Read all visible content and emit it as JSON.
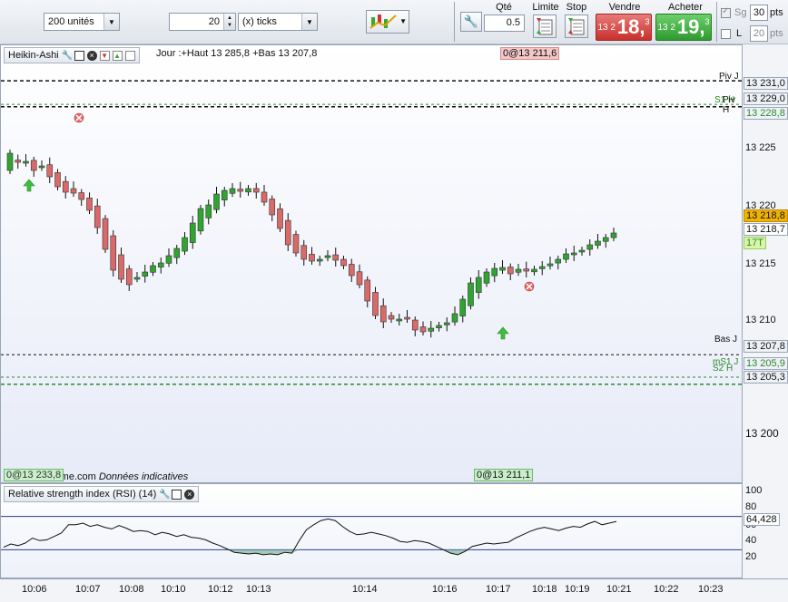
{
  "toolbar": {
    "quantity_units": "200 unités",
    "ticks_value": "20",
    "ticks_unit": "(x) ticks",
    "qty_label": "Qté",
    "qty_value": "0.5",
    "limit_label": "Limite",
    "stop_label": "Stop",
    "sell_label": "Vendre",
    "buy_label": "Acheter",
    "sell_small": "13 2",
    "sell_big": "18,",
    "sell_sup": "3",
    "buy_small": "13 2",
    "buy_big": "19,",
    "buy_sup": "3",
    "sg_label": "Sg",
    "sg_value": "30",
    "sg_unit": "pts",
    "l_label": "L",
    "l_value": "20",
    "l_unit": "pts",
    "colors": {
      "sell": "#d9534f",
      "buy": "#3faa3f"
    }
  },
  "main_chart": {
    "title": "Heikin-Ashi",
    "info": "Jour :+Haut 13 285,8 +Bas 13 207,8",
    "top_tag": "0@13 211,6",
    "bottom_tag": "0@13 211,1",
    "watermark_prefix": "© ",
    "watermark_brand": "ProRealTime.com",
    "watermark_rest": " Données indicatives",
    "left_tag": "0@13 233,8",
    "level_labels": {
      "piv_j": "Piv J",
      "piv_h": "Piv H",
      "s1_h": "S1 H",
      "bas_j": "Bas J",
      "ms1_j": "mS1 J",
      "s2_h": "S2 H"
    },
    "price_tags": {
      "piv_j": "13 231,0",
      "s1_h": "13 229,0",
      "piv_h": "13 228,8",
      "current": "13 218,8",
      "close": "13 218,7",
      "timer": "17T",
      "bas_j": "13 207,8",
      "ms1_j": "13 205,9",
      "s2_h": "13 205,3"
    },
    "y_ticks": [
      "13 225",
      "13 220",
      "13 215",
      "13 210",
      "13 200"
    ],
    "y_range": [
      13197,
      13234
    ]
  },
  "rsi_panel": {
    "title": "Relative strength index (RSI) (14)",
    "y_ticks": [
      "100",
      "80",
      "60",
      "40",
      "20"
    ],
    "value_tag": "64,428"
  },
  "time_axis": [
    "10:06",
    "10:07",
    "10:08",
    "10:10",
    "10:12",
    "10:13",
    "10:14",
    "10:16",
    "10:17",
    "10:18",
    "10:19",
    "10:21",
    "10:22",
    "10:23"
  ]
}
